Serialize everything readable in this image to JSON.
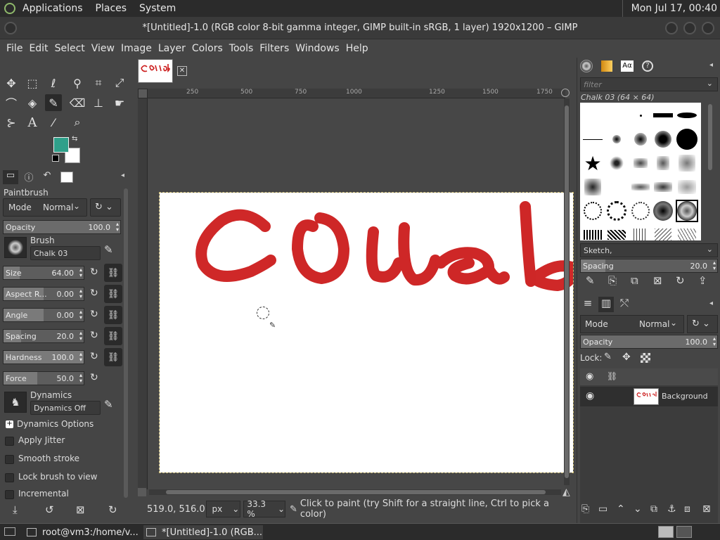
{
  "system_panel": {
    "menus": [
      "Applications",
      "Places",
      "System"
    ],
    "clock": "Mon Jul 17, 00:40"
  },
  "window": {
    "title": "*[Untitled]-1.0 (RGB color 8-bit gamma integer, GIMP built-in sRGB, 1 layer) 1920x1200 – GIMP"
  },
  "menubar": [
    "File",
    "Edit",
    "Select",
    "View",
    "Image",
    "Layer",
    "Colors",
    "Tools",
    "Filters",
    "Windows",
    "Help"
  ],
  "colors": {
    "foreground": "#2fa08a",
    "background": "#ffffff",
    "paint": "#cc1c1c"
  },
  "tool_options": {
    "title": "Paintbrush",
    "mode_label": "Mode",
    "mode_value": "Normal",
    "opacity_label": "Opacity",
    "opacity_value": "100.0",
    "brush_label": "Brush",
    "brush_value": "Chalk 03",
    "size_label": "Size",
    "size_value": "64.00",
    "aspect_label": "Aspect R...",
    "aspect_value": "0.00",
    "angle_label": "Angle",
    "angle_value": "0.00",
    "spacing_label": "Spacing",
    "spacing_value": "20.0",
    "hardness_label": "Hardness",
    "hardness_value": "100.0",
    "force_label": "Force",
    "force_value": "50.0",
    "dynamics_label": "Dynamics",
    "dynamics_value": "Dynamics Off",
    "dynamics_options": "Dynamics Options",
    "apply_jitter": "Apply Jitter",
    "smooth_stroke": "Smooth stroke",
    "lock_brush": "Lock brush to view",
    "incremental": "Incremental"
  },
  "ruler_top": [
    "250",
    "500",
    "750",
    "1000",
    "1250",
    "1500",
    "1750"
  ],
  "statusbar": {
    "coords": "519.0, 516.0",
    "unit": "px",
    "zoom": "33.3 %",
    "message": "Click to paint (try Shift for a straight line, Ctrl to pick a color)"
  },
  "brushes_panel": {
    "filter_placeholder": "filter",
    "selected_brush": "Chalk 03 (64 × 64)",
    "tag": "Sketch,",
    "spacing_label": "Spacing",
    "spacing_value": "20.0"
  },
  "layers_panel": {
    "mode_label": "Mode",
    "mode_value": "Normal",
    "opacity_label": "Opacity",
    "opacity_value": "100.0",
    "lock_label": "Lock:",
    "layer_name": "Background"
  },
  "taskbar": {
    "items": [
      "root@vm3:/home/v...",
      "*[Untitled]-1.0 (RGB..."
    ]
  }
}
